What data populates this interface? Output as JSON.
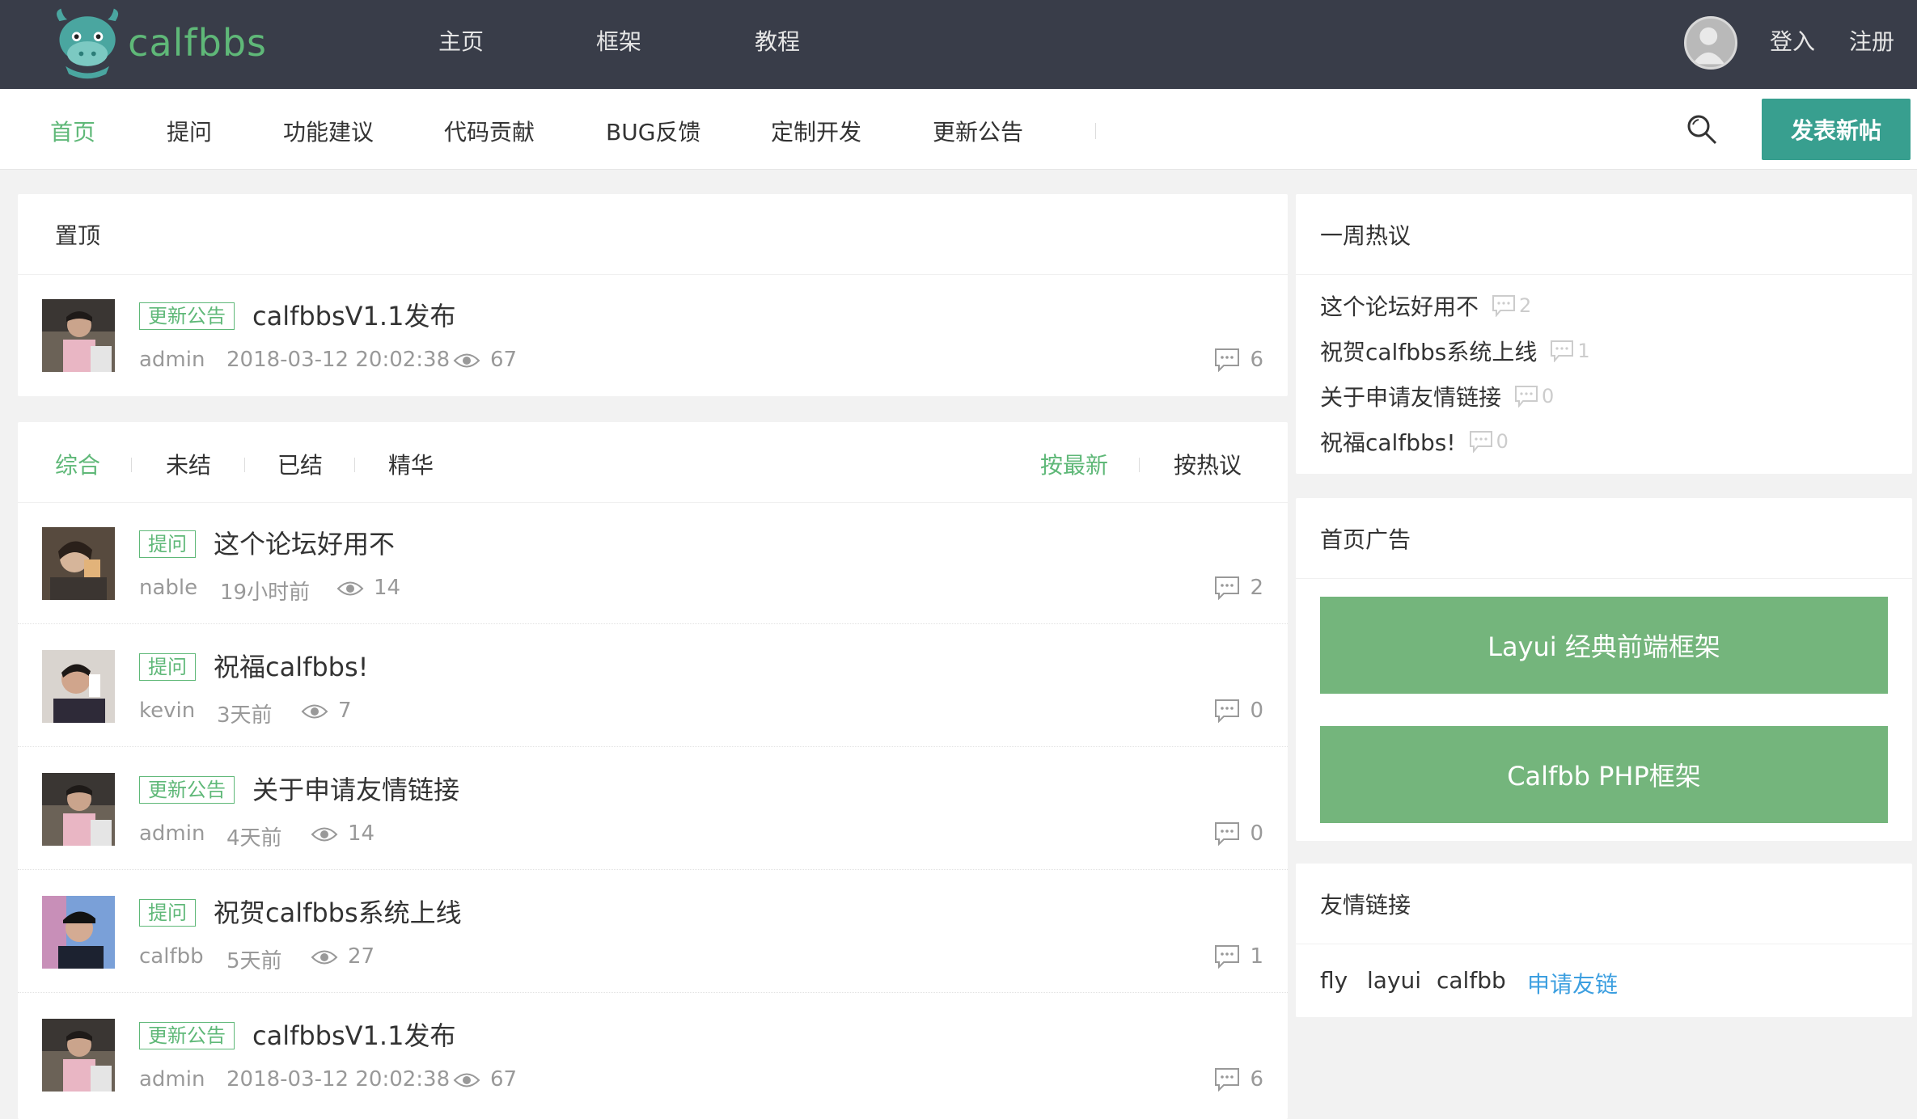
{
  "header": {
    "logo_text": "calfbbs",
    "nav": [
      "主页",
      "框架",
      "教程"
    ],
    "login": "登入",
    "register": "注册"
  },
  "subnav": {
    "items": [
      "首页",
      "提问",
      "功能建议",
      "代码贡献",
      "BUG反馈",
      "定制开发",
      "更新公告"
    ],
    "active_index": 0,
    "post_button": "发表新帖"
  },
  "pinned": {
    "title": "置顶",
    "post": {
      "badge": "更新公告",
      "title": "calfbbsV1.1发布",
      "author": "admin",
      "time": "2018-03-12 20:02:38",
      "views": "67",
      "comments": "6"
    }
  },
  "filters": {
    "left": [
      "综合",
      "未结",
      "已结",
      "精华"
    ],
    "right": [
      "按最新",
      "按热议"
    ],
    "active_left": 0,
    "active_right": 0
  },
  "posts": [
    {
      "badge": "提问",
      "title": "这个论坛好用不",
      "author": "nable",
      "time": "19小时前",
      "views": "14",
      "comments": "2"
    },
    {
      "badge": "提问",
      "title": "祝福calfbbs!",
      "author": "kevin",
      "time": "3天前",
      "views": "7",
      "comments": "0"
    },
    {
      "badge": "更新公告",
      "title": "关于申请友情链接",
      "author": "admin",
      "time": "4天前",
      "views": "14",
      "comments": "0"
    },
    {
      "badge": "提问",
      "title": "祝贺calfbbs系统上线",
      "author": "calfbb",
      "time": "5天前",
      "views": "27",
      "comments": "1"
    },
    {
      "badge": "更新公告",
      "title": "calfbbsV1.1发布",
      "author": "admin",
      "time": "2018-03-12 20:02:38",
      "views": "67",
      "comments": "6"
    }
  ],
  "sidebar": {
    "hot": {
      "title": "一周热议",
      "items": [
        {
          "title": "这个论坛好用不",
          "count": "2"
        },
        {
          "title": "祝贺calfbbs系统上线",
          "count": "1"
        },
        {
          "title": "关于申请友情链接",
          "count": "0"
        },
        {
          "title": "祝福calfbbs!",
          "count": "0"
        }
      ]
    },
    "ads": {
      "title": "首页广告",
      "items": [
        "Layui 经典前端框架",
        "Calfbb PHP框架"
      ]
    },
    "links": {
      "title": "友情链接",
      "items": [
        "fly",
        "layui",
        "calfbb"
      ],
      "apply": "申请友链"
    }
  },
  "colors": {
    "header_bg": "#393d49",
    "accent_green": "#5fb878",
    "post_button": "#389f8f",
    "ad_green": "#74b57c",
    "link_blue": "#3c9fe0"
  }
}
